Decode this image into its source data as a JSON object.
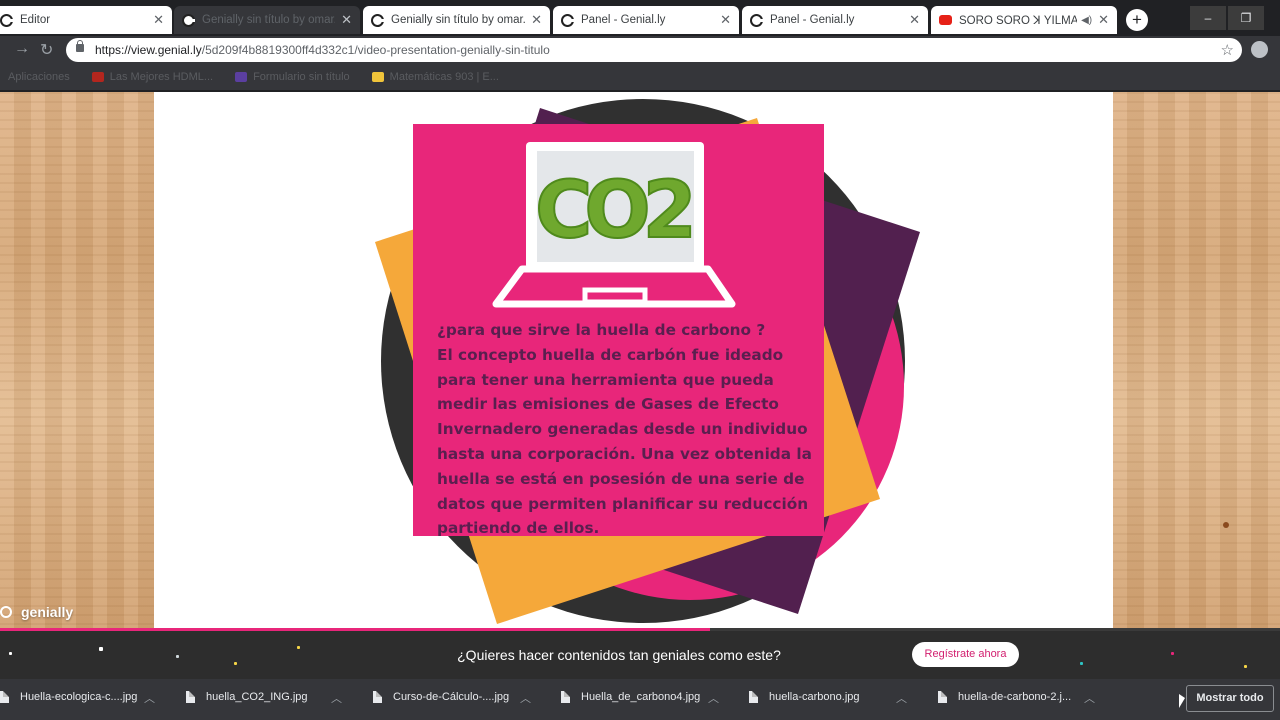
{
  "tabs": [
    {
      "title": "Editor",
      "favicon": "genially-icon"
    },
    {
      "title": "Genially sin título by omar.nateras",
      "favicon": "genially-icon"
    },
    {
      "title": "Genially sin título by omar.nate",
      "favicon": "genially-icon"
    },
    {
      "title": "Panel - Genial.ly",
      "favicon": "genially-icon"
    },
    {
      "title": "Panel - Genial.ly",
      "favicon": "genially-icon"
    },
    {
      "title": "SORO SORO ꓘ YILMAR DE",
      "favicon": "youtube-icon"
    }
  ],
  "window": {
    "minimize": "–",
    "restore": "❐",
    "new_tab": "+"
  },
  "address_bar": {
    "host": "https://view.genial.ly",
    "path": "/5d209f4b8819300ff4d332c1/video-presentation-genially-sin-titulo",
    "star": "☆"
  },
  "bookmarks": [
    {
      "label": "Aplicaciones",
      "icon": "apps-icon"
    },
    {
      "label": "Las Mejores HDML...",
      "icon": "youtube-icon"
    },
    {
      "label": "Formulario sin título",
      "icon": "forms-icon"
    },
    {
      "label": "Matemáticas 903 | E...",
      "icon": "bookmark-icon"
    }
  ],
  "slide": {
    "image_text": "CO2",
    "heading": "¿para que sirve la huella de carbono ?",
    "body": "El concepto huella de carbón fue ideado para tener una herramienta que pueda medir las emisiones de Gases de Efecto Invernadero generadas desde un individuo hasta una corporación. Una vez obtenida la huella se está en posesión de una serie de datos que permiten planificar su reducción partiendo de ellos.",
    "brand": "genially"
  },
  "progress": {
    "fraction": 0.555
  },
  "cta": {
    "text": "¿Quieres hacer contenidos tan geniales como este?",
    "button": "Regístrate ahora"
  },
  "downloads": [
    "Huella-ecologica-c....jpg",
    "huella_CO2_ING.jpg",
    "Curso-de-Cálculo-....jpg",
    "Huella_de_carbono4.jpg",
    "huella-carbono.jpg",
    "huella-de-carbono-2.j..."
  ],
  "downloads_show_all": "Mostrar todo",
  "colors": {
    "pink": "#e8267a",
    "orange": "#f5a83a",
    "purple": "#52204f",
    "dark_circle": "#303030",
    "grass_green": "#6fa82e"
  }
}
